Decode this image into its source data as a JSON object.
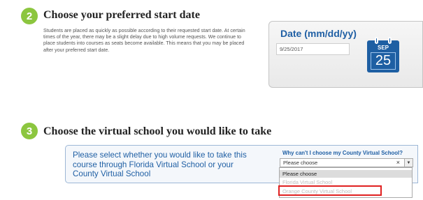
{
  "step2": {
    "number": "2",
    "heading": "Choose your preferred start date",
    "description": "Students are placed as quickly as possible according to their requested start date. At certain times of the year, there may be a slight delay due to high volume requests. We continue to place students into courses as seats become available. This means that you may be placed after your preferred start date."
  },
  "date_card": {
    "title": "Date (mm/dd/yy)",
    "value": "9/25/2017",
    "calendar_month": "SEP",
    "calendar_day": "25"
  },
  "step3": {
    "number": "3",
    "heading": "Choose the virtual school you would like to take"
  },
  "school_panel": {
    "prompt": "Please select whether you would like to take this course through Florida Virtual School or your County Virtual School",
    "why_link": "Why can't I choose my County Virtual School?",
    "select_value": "Please choose",
    "clear_label": "×",
    "dropdown_arrow": "▼",
    "options": [
      "Please choose",
      "Florida Virtual School",
      "Orange County Virtual School"
    ]
  },
  "colors": {
    "accent_green": "#8cc63f",
    "brand_blue": "#1f5fa4",
    "highlight_red": "#e02020"
  },
  "icons": {
    "calendar": "calendar-icon"
  }
}
